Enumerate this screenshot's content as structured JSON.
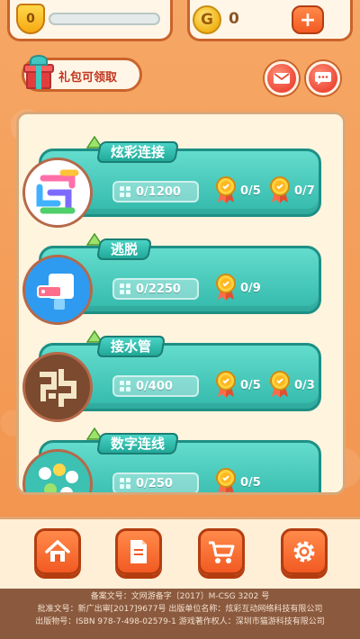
{
  "topbar": {
    "level_value": "0",
    "level_progress": 0,
    "coin_symbol": "G",
    "coin_value": "0",
    "add_label": "+"
  },
  "gift": {
    "label": "礼包可领取"
  },
  "games": [
    {
      "title": "炫彩连接",
      "progress": "0/1200",
      "medals": [
        {
          "count": "0/5",
          "color": "gold"
        },
        {
          "count": "0/7",
          "color": "gold"
        }
      ]
    },
    {
      "title": "逃脱",
      "progress": "0/2250",
      "medals": [
        {
          "count": "0/9",
          "color": "gold"
        }
      ]
    },
    {
      "title": "接水管",
      "progress": "0/400",
      "medals": [
        {
          "count": "0/5",
          "color": "gold"
        },
        {
          "count": "0/3",
          "color": "gold"
        }
      ]
    },
    {
      "title": "数字连线",
      "progress": "0/250",
      "medals": [
        {
          "count": "0/5",
          "color": "gold"
        }
      ]
    }
  ],
  "nav": {
    "items": [
      {
        "icon": "home-icon"
      },
      {
        "icon": "document-icon"
      },
      {
        "icon": "cart-icon"
      },
      {
        "icon": "gear-icon"
      }
    ]
  },
  "footer": {
    "line1": "备案文号：文网游备字〔2017〕M-CSG 3202 号",
    "line2": "批准文号：新广出审[2017]9677号   出版单位名称：炫彩互动网络科技有限公司",
    "line3": "出版物号：ISBN 978-7-498-02579-1   游戏著作权人：深圳市猫游科技有限公司"
  },
  "colors": {
    "accent": "#f25a22",
    "card": "#33b9ab",
    "panel": "#fff4de"
  }
}
